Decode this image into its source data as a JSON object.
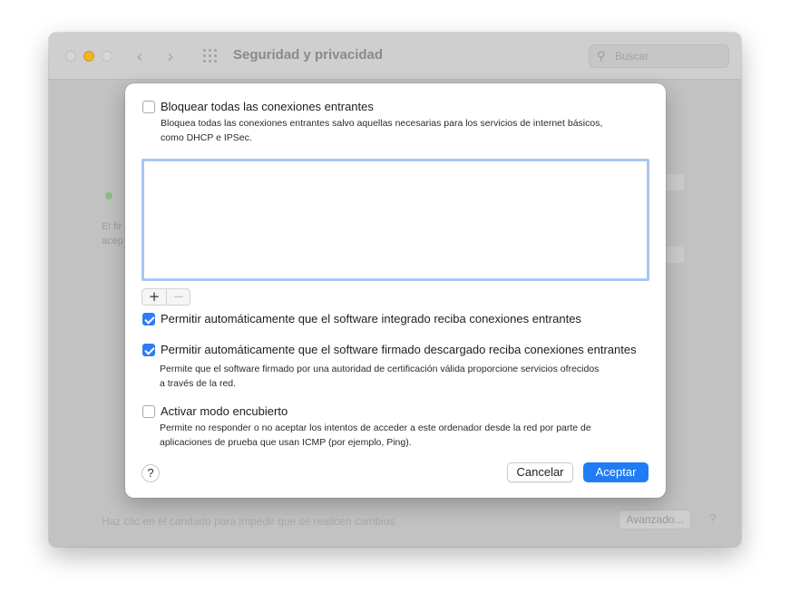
{
  "window": {
    "title": "Seguridad y privacidad",
    "search_placeholder": "Buscar",
    "background_text_1": "El fir",
    "background_text_2": "acep",
    "lock_message": "Haz clic en el candado para impedir que se realicen cambios",
    "advanced_button": "Avanzado...",
    "help_button": "?"
  },
  "dialog": {
    "block_all": {
      "label": "Bloquear todas las conexiones entrantes",
      "checked": false,
      "description_line1": "Bloquea todas las conexiones entrantes salvo aquellas necesarias para los servicios de internet básicos,",
      "description_line2": "como DHCP e IPSec."
    },
    "add_button": "+",
    "remove_button": "−",
    "allow_builtin": {
      "label": "Permitir automáticamente que el software integrado reciba conexiones entrantes",
      "checked": true
    },
    "allow_signed": {
      "label": "Permitir automáticamente que el software firmado descargado reciba conexiones entrantes",
      "checked": true,
      "description_line1": "Permite que el software firmado por una autoridad de certificación válida proporcione servicios ofrecidos",
      "description_line2": "a través de la red."
    },
    "stealth_mode": {
      "label": "Activar modo encubierto",
      "checked": false,
      "description_line1": "Permite no responder o no aceptar los intentos de acceder a este ordenador desde la red por parte de",
      "description_line2": "aplicaciones de prueba que usan ICMP (por ejemplo, Ping)."
    },
    "help_button": "?",
    "cancel_button": "Cancelar",
    "accept_button": "Aceptar"
  },
  "colors": {
    "accent": "#1f7cf5",
    "list_focus_ring": "#a9c6f3"
  }
}
